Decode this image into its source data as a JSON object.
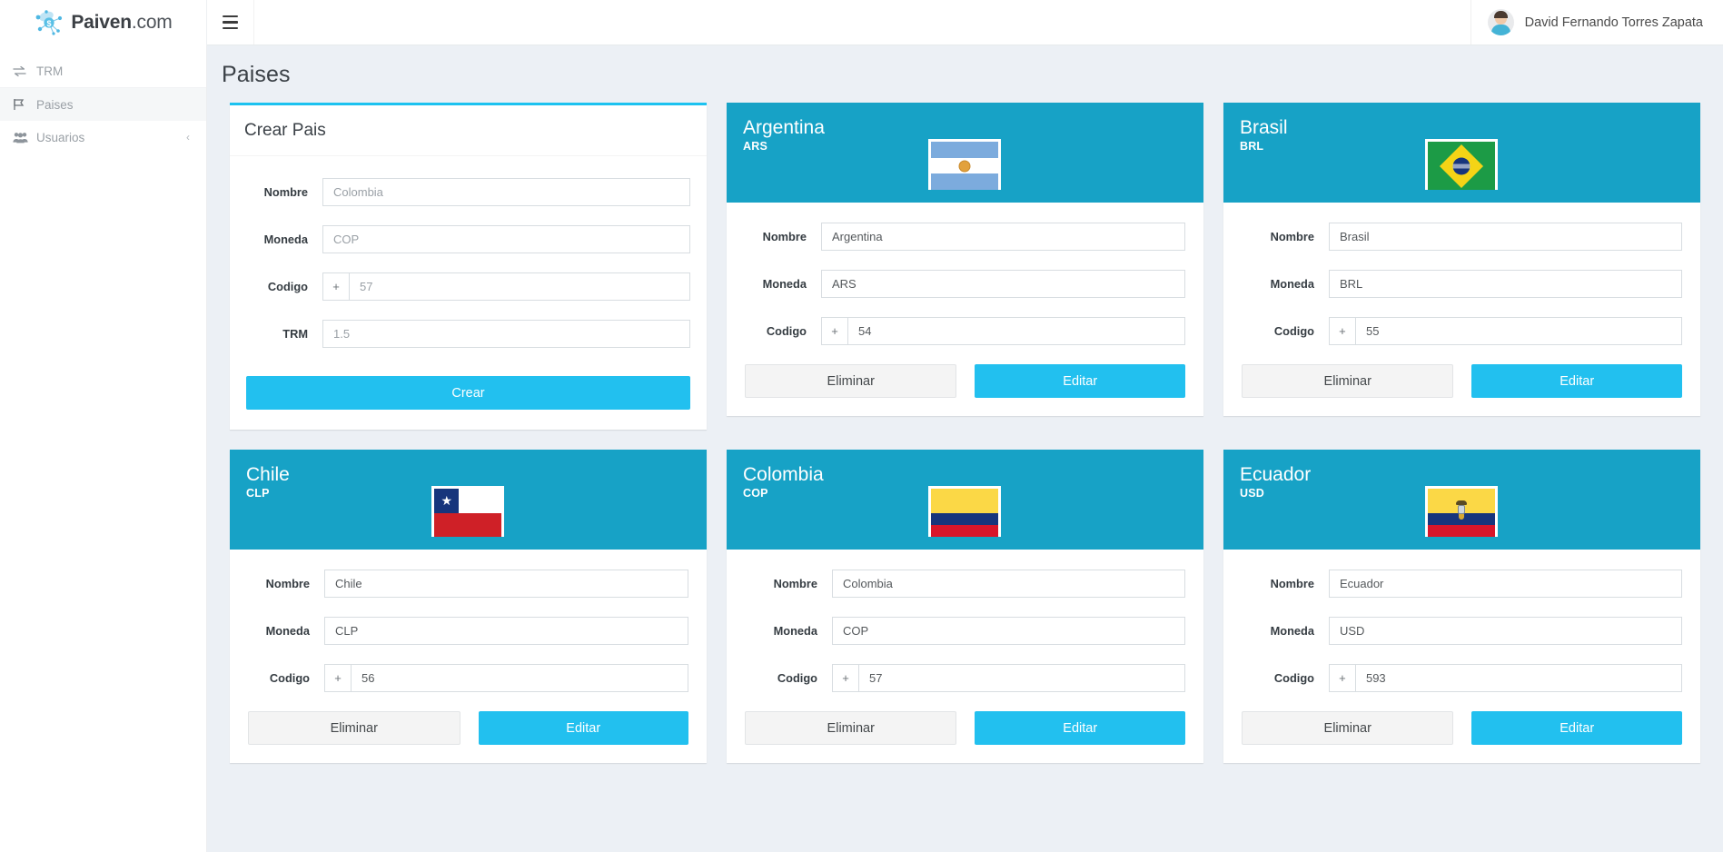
{
  "brand": {
    "name": "Paiven",
    "suffix": ".com"
  },
  "topbar": {
    "menu_icon": "hamburger-icon",
    "user_name": "David Fernando Torres Zapata",
    "avatar_icon": "user-avatar-icon"
  },
  "sidebar": {
    "items": [
      {
        "label": "TRM",
        "icon": "exchange-icon",
        "active": false,
        "chevron": ""
      },
      {
        "label": "Paises",
        "icon": "flag-icon",
        "active": true,
        "chevron": ""
      },
      {
        "label": "Usuarios",
        "icon": "users-icon",
        "active": false,
        "chevron": "‹"
      }
    ]
  },
  "page": {
    "title": "Paises"
  },
  "form": {
    "title": "Crear Pais",
    "fields": [
      {
        "label": "Nombre",
        "placeholder": "Colombia",
        "value": ""
      },
      {
        "label": "Moneda",
        "placeholder": "COP",
        "value": ""
      },
      {
        "label": "Codigo",
        "placeholder": "57",
        "value": "",
        "addon": "+"
      },
      {
        "label": "TRM",
        "placeholder": "1.5",
        "value": ""
      }
    ],
    "submit_label": "Crear"
  },
  "labels": {
    "nombre": "Nombre",
    "moneda": "Moneda",
    "codigo": "Codigo",
    "trm": "TRM",
    "addon_plus": "+",
    "delete": "Eliminar",
    "edit": "Editar"
  },
  "countries": [
    {
      "name": "Argentina",
      "currency": "ARS",
      "code": "54",
      "flag": "argentina-flag",
      "nombre_value": "Argentina",
      "moneda_value": "ARS"
    },
    {
      "name": "Brasil",
      "currency": "BRL",
      "code": "55",
      "flag": "brasil-flag",
      "nombre_value": "Brasil",
      "moneda_value": "BRL"
    },
    {
      "name": "Chile",
      "currency": "CLP",
      "code": "56",
      "flag": "chile-flag",
      "nombre_value": "Chile",
      "moneda_value": "CLP"
    },
    {
      "name": "Colombia",
      "currency": "COP",
      "code": "57",
      "flag": "colombia-flag",
      "nombre_value": "Colombia",
      "moneda_value": "COP"
    },
    {
      "name": "Ecuador",
      "currency": "USD",
      "code": "593",
      "flag": "ecuador-flag",
      "nombre_value": "Ecuador",
      "moneda_value": "USD"
    }
  ],
  "colors": {
    "card_header_blue": "#17a2c6",
    "accent_cyan": "#1cc2f0",
    "button_blue": "#22c0ef",
    "page_background": "#ecf0f5",
    "sidebar_background": "#ffffff"
  }
}
